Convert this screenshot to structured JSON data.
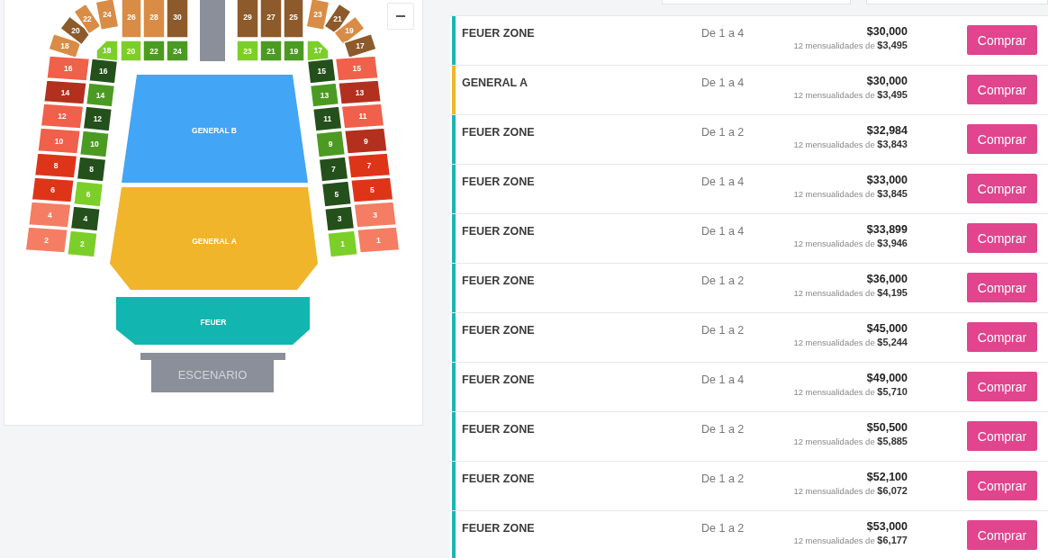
{
  "seat_map": {
    "sections": [
      {
        "label": "18",
        "color": "#d98c45"
      },
      {
        "label": "20",
        "color": "#8c5a2b"
      },
      {
        "label": "22",
        "color": "#d98c45"
      },
      {
        "label": "24",
        "color": "#d98c45"
      },
      {
        "label": "26",
        "color": "#d98c45"
      },
      {
        "label": "28",
        "color": "#d98c45"
      },
      {
        "label": "30",
        "color": "#8c5a2b"
      },
      {
        "label": "29",
        "color": "#8c5a2b"
      },
      {
        "label": "27",
        "color": "#8c5a2b"
      },
      {
        "label": "25",
        "color": "#8c5a2b"
      },
      {
        "label": "23",
        "color": "#d98c45"
      },
      {
        "label": "21",
        "color": "#8c5a2b"
      },
      {
        "label": "19",
        "color": "#d98c45"
      },
      {
        "label": "17",
        "color": "#8c5a2b"
      },
      {
        "label": "18",
        "color": "#7ccf29"
      },
      {
        "label": "20",
        "color": "#7ccf29"
      },
      {
        "label": "22",
        "color": "#4b9b23"
      },
      {
        "label": "24",
        "color": "#4b9b23"
      },
      {
        "label": "23",
        "color": "#7ccf29"
      },
      {
        "label": "21",
        "color": "#4b9b23"
      },
      {
        "label": "19",
        "color": "#4b9b23"
      },
      {
        "label": "17",
        "color": "#7ccf29"
      },
      {
        "label": "16",
        "color": "#f0604a"
      },
      {
        "label": "14",
        "color": "#b3301f"
      },
      {
        "label": "12",
        "color": "#f0604a"
      },
      {
        "label": "10",
        "color": "#f0604a"
      },
      {
        "label": "8",
        "color": "#de3519"
      },
      {
        "label": "6",
        "color": "#de3519"
      },
      {
        "label": "4",
        "color": "#f57d63"
      },
      {
        "label": "2",
        "color": "#f57d63"
      },
      {
        "label": "16",
        "color": "#24501b"
      },
      {
        "label": "14",
        "color": "#4b9b23"
      },
      {
        "label": "12",
        "color": "#24501b"
      },
      {
        "label": "10",
        "color": "#4b9b23"
      },
      {
        "label": "8",
        "color": "#24501b"
      },
      {
        "label": "6",
        "color": "#7ccf29"
      },
      {
        "label": "4",
        "color": "#24501b"
      },
      {
        "label": "2",
        "color": "#7ccf29"
      },
      {
        "label": "15",
        "color": "#24501b"
      },
      {
        "label": "13",
        "color": "#4b9b23"
      },
      {
        "label": "11",
        "color": "#24501b"
      },
      {
        "label": "9",
        "color": "#4b9b23"
      },
      {
        "label": "7",
        "color": "#24501b"
      },
      {
        "label": "5",
        "color": "#24501b"
      },
      {
        "label": "3",
        "color": "#24501b"
      },
      {
        "label": "1",
        "color": "#7ccf29"
      },
      {
        "label": "15",
        "color": "#f0604a"
      },
      {
        "label": "13",
        "color": "#b3301f"
      },
      {
        "label": "11",
        "color": "#f0604a"
      },
      {
        "label": "9",
        "color": "#b3301f"
      },
      {
        "label": "7",
        "color": "#de3519"
      },
      {
        "label": "5",
        "color": "#de3519"
      },
      {
        "label": "3",
        "color": "#f57d63"
      },
      {
        "label": "1",
        "color": "#f57d63"
      }
    ],
    "zones": [
      {
        "label": "GENERAL B",
        "color": "#42a5f5"
      },
      {
        "label": "GENERAL A",
        "color": "#f0b52a"
      },
      {
        "label": "FEUER",
        "color": "#12b5b0"
      }
    ],
    "stage": {
      "label": "ESCENARIO"
    }
  },
  "tickets": [
    {
      "zone": "FEUER ZONE",
      "color": "#1cb5b2",
      "quantity": "De 1 a 4",
      "price": "$30,000",
      "installments": "12 mensualidades de **$3,495**",
      "button": "Comprar"
    },
    {
      "zone": "GENERAL A",
      "color": "#f0b52a",
      "quantity": "De 1 a 4",
      "price": "$30,000",
      "installments": "12 mensualidades de **$3,495**",
      "button": "Comprar"
    },
    {
      "zone": "FEUER ZONE",
      "color": "#1cb5b2",
      "quantity": "De 1 a 2",
      "price": "$32,984",
      "installments": "12 mensualidades de **$3,843**",
      "button": "Comprar"
    },
    {
      "zone": "FEUER ZONE",
      "color": "#1cb5b2",
      "quantity": "De 1 a 4",
      "price": "$33,000",
      "installments": "12 mensualidades de **$3,845**",
      "button": "Comprar"
    },
    {
      "zone": "FEUER ZONE",
      "color": "#1cb5b2",
      "quantity": "De 1 a 4",
      "price": "$33,899",
      "installments": "12 mensualidades de **$3,946**",
      "button": "Comprar"
    },
    {
      "zone": "FEUER ZONE",
      "color": "#1cb5b2",
      "quantity": "De 1 a 2",
      "price": "$36,000",
      "installments": "12 mensualidades de **$4,195**",
      "button": "Comprar"
    },
    {
      "zone": "FEUER ZONE",
      "color": "#1cb5b2",
      "quantity": "De 1 a 2",
      "price": "$45,000",
      "installments": "12 mensualidades de **$5,244**",
      "button": "Comprar"
    },
    {
      "zone": "FEUER ZONE",
      "color": "#1cb5b2",
      "quantity": "De 1 a 4",
      "price": "$49,000",
      "installments": "12 mensualidades de **$5,710**",
      "button": "Comprar"
    },
    {
      "zone": "FEUER ZONE",
      "color": "#1cb5b2",
      "quantity": "De 1 a 2",
      "price": "$50,500",
      "installments": "12 mensualidades de **$5,885**",
      "button": "Comprar"
    },
    {
      "zone": "FEUER ZONE",
      "color": "#1cb5b2",
      "quantity": "De 1 a 2",
      "price": "$52,100",
      "installments": "12 mensualidades de **$6,072**",
      "button": "Comprar"
    },
    {
      "zone": "FEUER ZONE",
      "color": "#1cb5b2",
      "quantity": "De 1 a 2",
      "price": "$53,000",
      "installments": "12 mensualidades de **$6,177**",
      "button": "Comprar"
    }
  ]
}
